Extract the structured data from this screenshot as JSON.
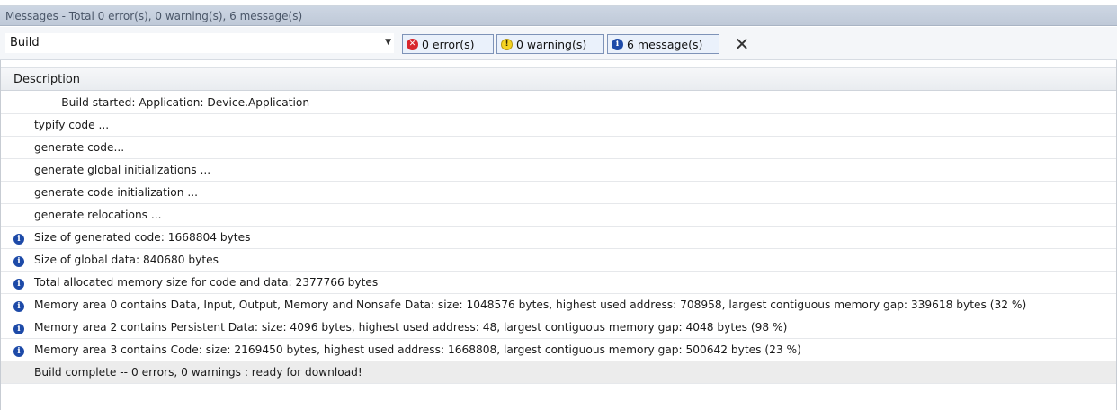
{
  "window": {
    "title": "Messages - Total 0 error(s), 0 warning(s), 6 message(s)"
  },
  "toolbar": {
    "source_select": {
      "value": "Build",
      "arrow_icon": "chevron-down-icon"
    },
    "filters": {
      "errors": {
        "label": "0 error(s)",
        "icon": "error-icon",
        "color": "#d8262c"
      },
      "warnings": {
        "label": "0 warning(s)",
        "icon": "warning-icon",
        "color": "#f4d322"
      },
      "messages": {
        "label": "6 message(s)",
        "icon": "info-icon",
        "color": "#1d4aa8"
      }
    },
    "clear_icon": "clear-icon"
  },
  "table": {
    "column_header": "Description",
    "rows": [
      {
        "icon": "",
        "text": "------ Build started: Application: Device.Application -------"
      },
      {
        "icon": "",
        "text": "typify code ..."
      },
      {
        "icon": "",
        "text": "generate code..."
      },
      {
        "icon": "",
        "text": "generate global initializations ..."
      },
      {
        "icon": "",
        "text": "generate code initialization ..."
      },
      {
        "icon": "",
        "text": "generate relocations ..."
      },
      {
        "icon": "info-icon",
        "text": "Size of generated code: 1668804 bytes"
      },
      {
        "icon": "info-icon",
        "text": "Size of global data: 840680 bytes"
      },
      {
        "icon": "info-icon",
        "text": "Total allocated memory size for code and data: 2377766 bytes"
      },
      {
        "icon": "info-icon",
        "text": "Memory area 0 contains  Data, Input, Output, Memory and Nonsafe Data: size: 1048576 bytes, highest used address: 708958, largest contiguous memory gap: 339618 bytes (32 %)"
      },
      {
        "icon": "info-icon",
        "text": "Memory area 2 contains  Persistent Data: size: 4096 bytes, highest used address: 48, largest contiguous memory gap: 4048 bytes (98 %)"
      },
      {
        "icon": "info-icon",
        "text": "Memory area 3 contains  Code: size: 2169450 bytes, highest used address: 1668808, largest contiguous memory gap: 500642 bytes (23 %)"
      },
      {
        "icon": "",
        "text": "Build complete -- 0 errors, 0 warnings : ready for download!"
      }
    ]
  }
}
